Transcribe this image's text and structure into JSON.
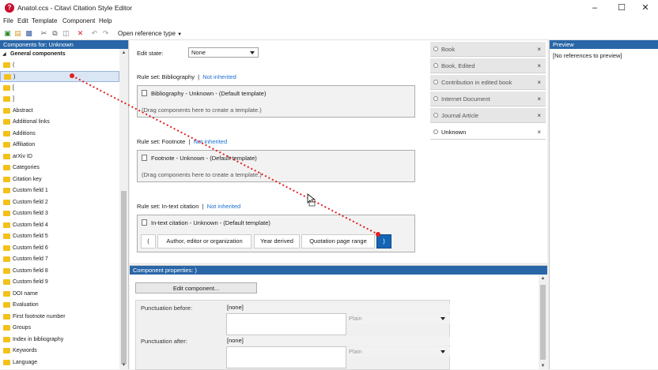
{
  "window": {
    "title": "Anatol.ccs - Citavi Citation Style Editor",
    "icon": "?"
  },
  "menu": [
    "File",
    "Edit",
    "Template",
    "Component",
    "Help"
  ],
  "toolbar": {
    "open_reference_type": "Open reference type"
  },
  "left": {
    "header": "Components for: Unknown",
    "group_label": "General components",
    "items": [
      "(",
      ")",
      "[",
      "]",
      "Abstract",
      "Additional links",
      "Additions",
      "Affiliation",
      "arXiv ID",
      "Categories",
      "Citation key",
      "Custom field 1",
      "Custom field 2",
      "Custom field 3",
      "Custom field 4",
      "Custom field 5",
      "Custom field 6",
      "Custom field 7",
      "Custom field 8",
      "Custom field 9",
      "DOI name",
      "Evaluation",
      "First footnote number",
      "Groups",
      "Index in bibliography",
      "Keywords",
      "Language"
    ]
  },
  "main": {
    "edit_state_label": "Edit state:",
    "edit_state_value": "None",
    "bibliography": {
      "label": "Rule set: Bibliography",
      "sep": "|",
      "link": "Not inherited",
      "template_title": "Bibliography - Unknown - (Default template)",
      "drag_text": "(Drag components here to create a template.)"
    },
    "footnote": {
      "label": "Rule set: Footnote",
      "sep": "|",
      "link": "Not inherited",
      "template_title": "Footnote - Unknown - (Default template)",
      "drag_text": "(Drag components here to create a template.)"
    },
    "intext": {
      "label": "Rule set: In-text citation",
      "sep": "|",
      "link": "Not inherited",
      "template_title": "In-text citation - Unknown - (Default template)",
      "components": [
        "(",
        "Author, editor or organization",
        "Year derived",
        "Quotation page range",
        ")"
      ]
    }
  },
  "tabs": [
    {
      "label": "Book",
      "close": "×"
    },
    {
      "label": "Book, Edited",
      "close": "×"
    },
    {
      "label": "Contribution in edited book",
      "close": "×"
    },
    {
      "label": "Internet Document",
      "close": "×"
    },
    {
      "label": "Journal Article",
      "close": "×"
    },
    {
      "label": "Unknown",
      "close": "×"
    }
  ],
  "preview": {
    "header": "Preview",
    "text": "[No references to preview]"
  },
  "properties": {
    "header": "Component properties:  )",
    "edit_button": "Edit component...",
    "punct_before_label": "Punctuation before:",
    "punct_before_value": "[none]",
    "punct_after_label": "Punctuation after:",
    "punct_after_value": "[none]",
    "plain": "Plain"
  },
  "colors": {
    "accent": "#2966a8",
    "selected_component": "#1565b5",
    "link": "#1a6fd0",
    "drag_line": "#e02020"
  }
}
